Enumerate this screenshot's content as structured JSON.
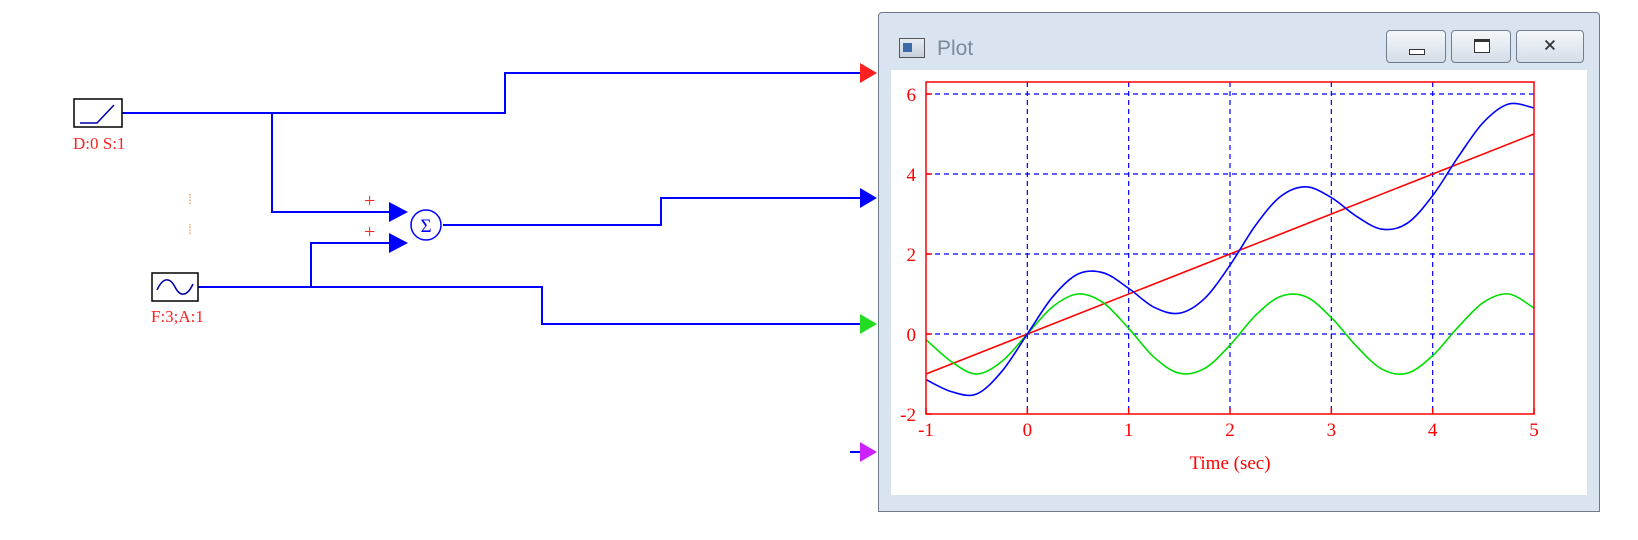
{
  "diagram": {
    "ramp_block": {
      "icon": "ramp-icon",
      "label": "D:0 S:1"
    },
    "sine_block": {
      "icon": "sine-wave-icon",
      "label": "F:3;A:1"
    },
    "sum_block": {
      "icon": "sigma-icon",
      "symbol": "Σ",
      "input_signs": [
        "+",
        "+"
      ]
    },
    "colors": {
      "wire": "#0000ff",
      "label": "#ff2020",
      "port1": "#ff2020",
      "port2": "#0000ff",
      "port3": "#22dd22",
      "port4": "#cc22ff"
    }
  },
  "plot_window": {
    "title": "Plot",
    "icon": "app-window-icon",
    "buttons": {
      "minimize": "minimize-icon",
      "maximize": "maximize-icon",
      "close": "close-icon",
      "close_glyph": "🗙"
    }
  },
  "chart_data": {
    "type": "line",
    "xlabel": "Time (sec)",
    "ylabel": "",
    "xlim": [
      -1,
      5
    ],
    "ylim": [
      -2,
      6.3
    ],
    "xticks": [
      -1,
      0,
      1,
      2,
      3,
      4,
      5
    ],
    "yticks": [
      -2,
      0,
      2,
      4,
      6
    ],
    "xtick_labels": [
      "-1",
      "0",
      "1",
      "2",
      "3",
      "4",
      "5"
    ],
    "ytick_labels": [
      "-2",
      "0",
      "2",
      "4",
      "6"
    ],
    "grid": true,
    "series": [
      {
        "color": "#ff0000",
        "x": [
          -1,
          5
        ],
        "y": [
          -1,
          5
        ]
      },
      {
        "color": "#00dd00",
        "x": [
          -1,
          -0.75,
          -0.5,
          -0.25,
          0,
          0.25,
          0.5,
          0.75,
          1,
          1.25,
          1.5,
          1.75,
          2,
          2.25,
          2.5,
          2.75,
          3,
          3.25,
          3.5,
          3.75,
          4,
          4.25,
          4.5,
          4.75,
          5
        ],
        "y": [
          -0.14,
          -0.69,
          -1.0,
          -0.68,
          0.0,
          0.68,
          1.0,
          0.78,
          0.14,
          -0.58,
          -0.98,
          -0.86,
          -0.28,
          0.46,
          0.94,
          0.93,
          0.41,
          -0.31,
          -0.88,
          -0.98,
          -0.54,
          0.17,
          0.79,
          1.0,
          0.65
        ]
      },
      {
        "color": "#0000ff",
        "x": [
          -1,
          -0.75,
          -0.5,
          -0.25,
          0,
          0.25,
          0.5,
          0.75,
          1,
          1.25,
          1.5,
          1.75,
          2,
          2.25,
          2.5,
          2.75,
          3,
          3.25,
          3.5,
          3.75,
          4,
          4.25,
          4.5,
          4.75,
          5
        ],
        "y": [
          -1.14,
          -1.44,
          -1.5,
          -0.93,
          0.0,
          0.93,
          1.5,
          1.53,
          1.14,
          0.67,
          0.52,
          0.89,
          1.72,
          2.71,
          3.44,
          3.68,
          3.41,
          2.94,
          2.62,
          2.77,
          3.46,
          4.42,
          5.29,
          5.75,
          5.65
        ]
      }
    ]
  }
}
